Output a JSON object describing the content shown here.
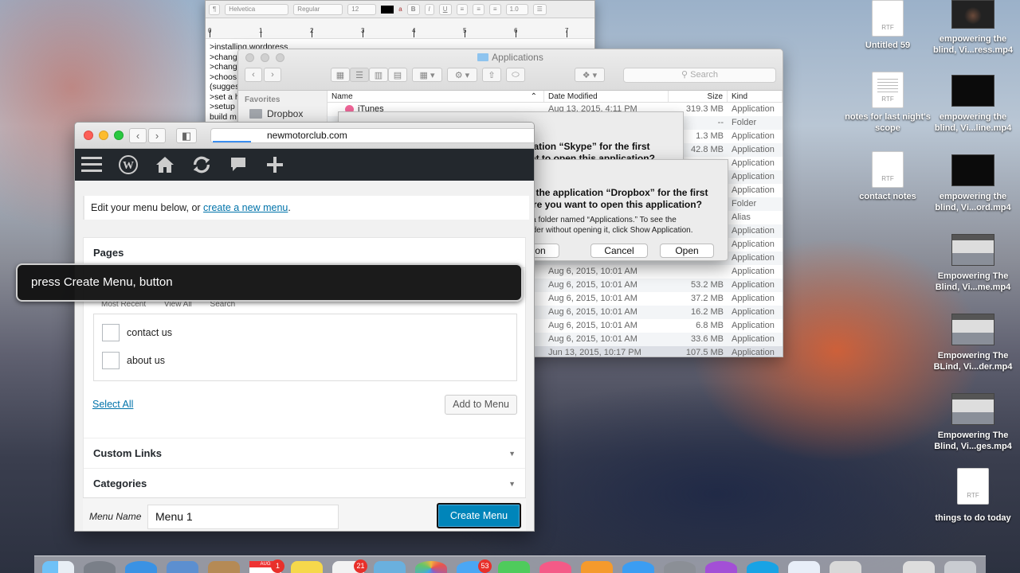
{
  "desktop": {
    "icons": [
      {
        "label": "Untitled 59",
        "kind": "rtf"
      },
      {
        "label": "empowering the blind, Vi...ress.mp4",
        "kind": "video-face"
      },
      {
        "label": "notes for last night's scope",
        "kind": "rtf"
      },
      {
        "label": "empowering the blind, Vi...line.mp4",
        "kind": "video"
      },
      {
        "label": "contact notes",
        "kind": "rtf"
      },
      {
        "label": "empowering the blind, Vi...ord.mp4",
        "kind": "video"
      },
      {
        "label": "Empowering The Blind, Vi...me.mp4",
        "kind": "video-screen"
      },
      {
        "label": "Empowering The BLind, Vi...der.mp4",
        "kind": "video-screen"
      },
      {
        "label": "Empowering The Blind, Vi...ges.mp4",
        "kind": "video-screen"
      },
      {
        "label": "things to do today",
        "kind": "rtf"
      }
    ],
    "rtf_ext": "RTF"
  },
  "textedit": {
    "toolbar": {
      "style": "¶",
      "font": "Helvetica",
      "weight": "Regular",
      "size": "12",
      "spacing": "1.0"
    },
    "ruler_numbers": [
      "0",
      "1",
      "2",
      "3",
      "4",
      "5",
      "6",
      "7"
    ],
    "lines": [
      ">installing wordpress",
      ">chang",
      ">chang",
      ">choos",
      "(sugges",
      ">set a h",
      ">setup",
      " build m"
    ]
  },
  "finder": {
    "title": "Applications",
    "search_placeholder": "Search",
    "sidebar": {
      "heading": "Favorites",
      "items": [
        "Dropbox"
      ]
    },
    "columns": {
      "name": "Name",
      "date": "Date Modified",
      "size": "Size",
      "kind": "Kind"
    },
    "rows": [
      {
        "name": "iTunes",
        "date": "Aug 13, 2015, 4:11 PM",
        "size": "319.3 MB",
        "kind": "Application"
      },
      {
        "name": "",
        "date": "",
        "size": "--",
        "kind": "Folder"
      },
      {
        "name": "",
        "date": "",
        "size": "1.3 MB",
        "kind": "Application"
      },
      {
        "name": "",
        "date": "",
        "size": "42.8 MB",
        "kind": "Application"
      },
      {
        "name": "",
        "date": "",
        "size": "",
        "kind": "Application"
      },
      {
        "name": "",
        "date": "",
        "size": "",
        "kind": "Application"
      },
      {
        "name": "",
        "date": "",
        "size": "",
        "kind": "Application"
      },
      {
        "name": "",
        "date": "",
        "size": "",
        "kind": "Folder"
      },
      {
        "name": "",
        "date": "",
        "size": "",
        "kind": "Alias"
      },
      {
        "name": "",
        "date": "",
        "size": "",
        "kind": "Application"
      },
      {
        "name": "",
        "date": "",
        "size": "",
        "kind": "Application"
      },
      {
        "name": "",
        "date": "",
        "size": "",
        "kind": "Application"
      },
      {
        "name": "",
        "date": "Aug 6, 2015, 10:01 AM",
        "size": "",
        "kind": "Application"
      },
      {
        "name": "",
        "date": "Aug 6, 2015, 10:01 AM",
        "size": "53.2 MB",
        "kind": "Application"
      },
      {
        "name": "",
        "date": "Aug 6, 2015, 10:01 AM",
        "size": "37.2 MB",
        "kind": "Application"
      },
      {
        "name": "",
        "date": "Aug 6, 2015, 10:01 AM",
        "size": "16.2 MB",
        "kind": "Application"
      },
      {
        "name": "",
        "date": "Aug 6, 2015, 10:01 AM",
        "size": "6.8 MB",
        "kind": "Application"
      },
      {
        "name": "",
        "date": "Aug 6, 2015, 10:01 AM",
        "size": "33.6 MB",
        "kind": "Application"
      },
      {
        "name": "",
        "date": "Jun 13, 2015, 10:17 PM",
        "size": "107.5 MB",
        "kind": "Application"
      }
    ]
  },
  "skype_dialog": {
    "title": "You are opening the application “Skype” for the first time. Are you sure you want to open this application?"
  },
  "dropbox_dialog": {
    "title": "You are opening the application “Dropbox” for the first time. Are you sure you want to open this application?",
    "body": "The application is in a folder named “Applications.” To see the application in the Finder without opening it, click Show Application.",
    "buttons": {
      "show": "Show Application",
      "cancel": "Cancel",
      "open": "Open"
    }
  },
  "browser": {
    "url": "newmotorclub.com",
    "wp": {
      "notice_text": "Edit your menu below, or ",
      "notice_link": "create a new menu",
      "notice_end": ".",
      "sections": {
        "pages": "Pages",
        "custom_links": "Custom Links",
        "categories": "Categories"
      },
      "tabs": [
        "Most Recent",
        "View All",
        "Search"
      ],
      "pages": [
        "contact us",
        "about us"
      ],
      "select_all": "Select All",
      "add_to_menu": "Add to Menu",
      "menu_name_label": "Menu Name",
      "menu_name_value": "Menu 1",
      "create_menu": "Create Menu"
    }
  },
  "voiceover": {
    "caption": "press Create Menu, button"
  },
  "dock": {
    "badges": {
      "calendar": "AUG",
      "calendar_badge": "1",
      "reminders_badge": "21",
      "messages_badge": "53"
    }
  },
  "colors": {
    "wp_admin_bar": "#23282d",
    "wp_primary": "#0085ba",
    "wp_link": "#0073aa",
    "mac_close": "#fc5f57",
    "mac_min": "#fdbc2e",
    "mac_max": "#29c840"
  }
}
